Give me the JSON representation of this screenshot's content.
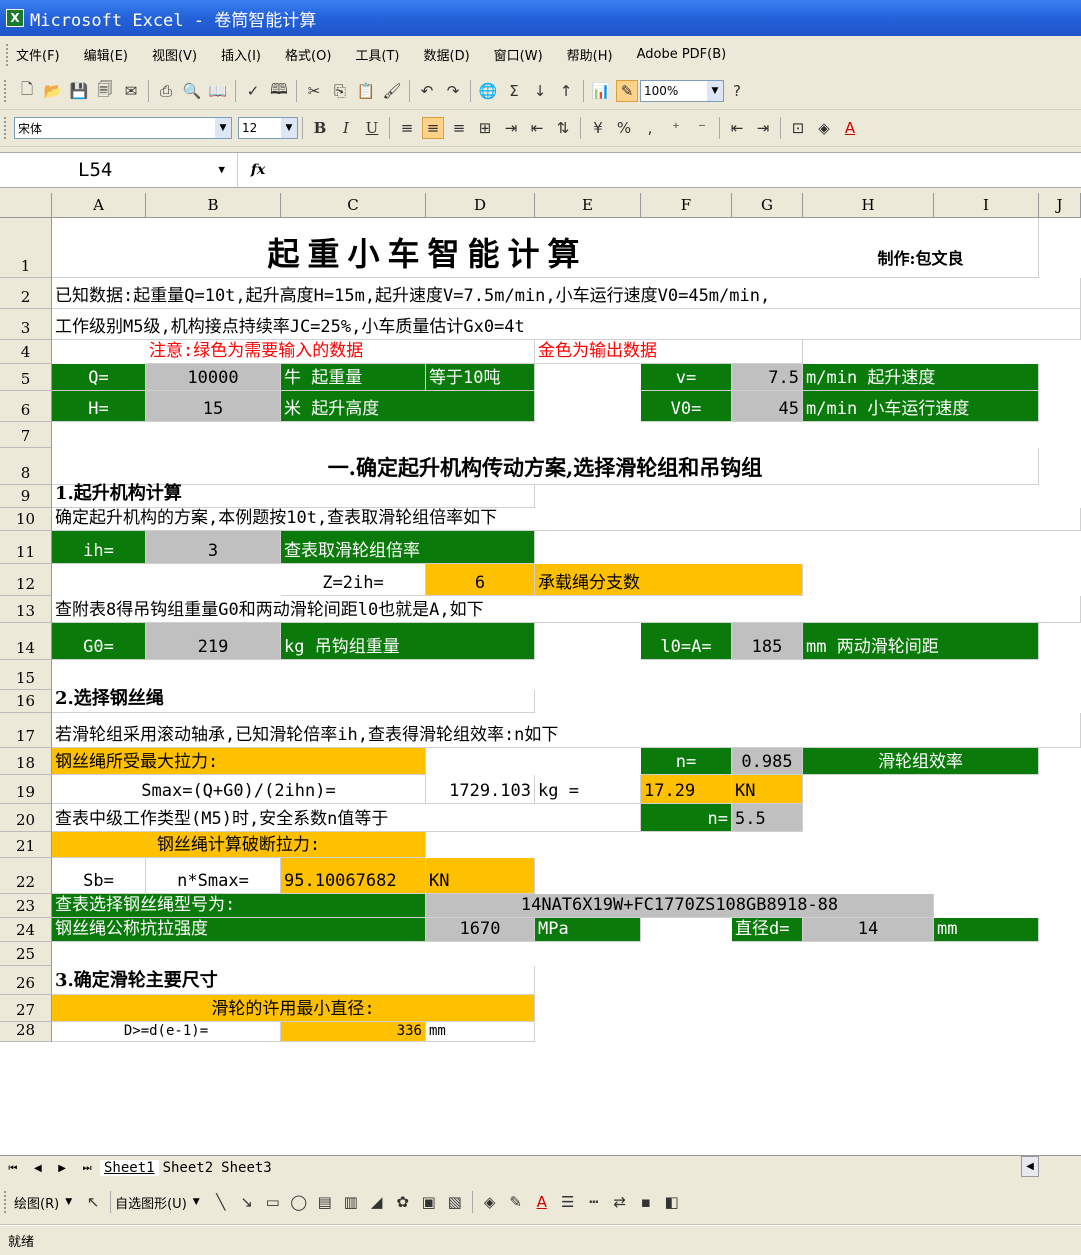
{
  "window": {
    "title": "Microsoft Excel - 卷筒智能计算",
    "icon": "excel-icon"
  },
  "menu": [
    "文件(F)",
    "编辑(E)",
    "视图(V)",
    "插入(I)",
    "格式(O)",
    "工具(T)",
    "数据(D)",
    "窗口(W)",
    "帮助(H)",
    "Adobe PDF(B)"
  ],
  "toolbar": {
    "zoom": "100%",
    "font": "宋体",
    "size": "12",
    "bold": "B",
    "italic": "I",
    "underline": "U",
    "percent": "%",
    "comma": ","
  },
  "formula": {
    "namebox": "L54",
    "fx": "fx",
    "value": ""
  },
  "columns": [
    "A",
    "B",
    "C",
    "D",
    "E",
    "F",
    "G",
    "H",
    "I",
    "J"
  ],
  "rows": [
    "1",
    "2",
    "3",
    "4",
    "5",
    "6",
    "7",
    "8",
    "9",
    "10",
    "11",
    "12",
    "13",
    "14",
    "15",
    "16",
    "17",
    "18",
    "19",
    "20",
    "21",
    "22",
    "23",
    "24",
    "25",
    "26",
    "27",
    "28"
  ],
  "cells": {
    "r1_title": "起重小车智能计算",
    "r1_author": "制作:包文良",
    "r2": "已知数据:起重量Q=10t,起升高度H=15m,起升速度V=7.5m/min,小车运行速度V0=45m/min,",
    "r3": "工作级别M5级,机构接点持续率JC=25%,小车质量估计Gx0=4t",
    "r4_note1": "注意:绿色为需要输入的数据",
    "r4_note2": "金色为输出数据",
    "r5_a": "Q=",
    "r5_b": "10000",
    "r5_c": "牛 起重量",
    "r5_d": "等于10吨",
    "r5_f": "v=",
    "r5_g": "7.5",
    "r5_h": "m/min 起升速度",
    "r6_a": "H=",
    "r6_b": "15",
    "r6_c": "米 起升高度",
    "r6_f": "V0=",
    "r6_g": "45",
    "r6_h": "m/min 小车运行速度",
    "r8": "一.确定起升机构传动方案,选择滑轮组和吊钩组",
    "r9": "1.起升机构计算",
    "r10": "确定起升机构的方案,本例题按10t,查表取滑轮组倍率如下",
    "r11_a": "ih=",
    "r11_b": "3",
    "r11_c": "查表取滑轮组倍率",
    "r12_c": "Z=2ih=",
    "r12_d": "6",
    "r12_e": "承载绳分支数",
    "r13": "查附表8得吊钩组重量G0和两动滑轮间距l0也就是A,如下",
    "r14_a": "G0=",
    "r14_b": "219",
    "r14_c": "kg 吊钩组重量",
    "r14_f": "l0=A=",
    "r14_g": "185",
    "r14_h": "mm  两动滑轮间距",
    "r16": "2.选择钢丝绳",
    "r17": "若滑轮组采用滚动轴承,已知滑轮倍率ih,查表得滑轮组效率:n如下",
    "r18_a": "钢丝绳所受最大拉力:",
    "r18_f": "n=",
    "r18_g": "0.985",
    "r18_h": "滑轮组效率",
    "r19_b": "Smax=(Q+G0)/(2ihn)=",
    "r19_d": "1729.103",
    "r19_e": "kg   =",
    "r19_f": "17.29",
    "r19_g": "KN",
    "r20_a": "查表中级工作类型(M5)时,安全系数n值等于",
    "r20_f": "n=",
    "r20_g": "5.5",
    "r21_a": "钢丝绳计算破断拉力:",
    "r22_a": "Sb=",
    "r22_b": "n*Smax=",
    "r22_c": "95.10067682",
    "r22_d": "KN",
    "r23_a": "查表选择钢丝绳型号为:",
    "r23_d": "14NAT6X19W+FC1770ZS108GB8918-88",
    "r24_a": "钢丝绳公称抗拉强度",
    "r24_d": "1670",
    "r24_e": "MPa",
    "r24_g": "直径d=",
    "r24_h": "14",
    "r24_i": "mm",
    "r26": "3.确定滑轮主要尺寸",
    "r27": "滑轮的许用最小直径:",
    "r28_b": "D>=d(e-1)=",
    "r28_c": "336",
    "r28_d": "mm"
  },
  "sheets": [
    "Sheet1",
    "Sheet2",
    "Sheet3"
  ],
  "drawbar": {
    "draw": "绘图(R)",
    "autoshapes": "自选图形(U)"
  },
  "status": "就绪"
}
